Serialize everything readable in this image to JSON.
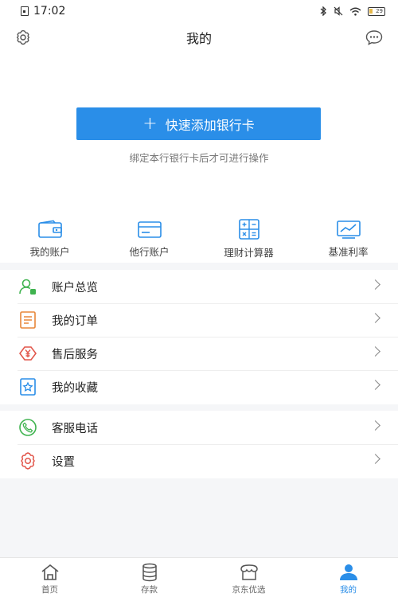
{
  "status_bar": {
    "time": "17:02",
    "battery_level": "29"
  },
  "header": {
    "title": "我的"
  },
  "add_card": {
    "button_label": "快速添加银行卡",
    "hint": "绑定本行银行卡后才可进行操作"
  },
  "quick_entries": [
    {
      "label": "我的账户",
      "icon": "wallet-icon"
    },
    {
      "label": "他行账户",
      "icon": "bank-card-icon"
    },
    {
      "label": "理财计算器",
      "icon": "calculator-icon"
    },
    {
      "label": "基准利率",
      "icon": "trend-chart-icon"
    }
  ],
  "menu_group_1": [
    {
      "label": "账户总览",
      "icon": "user-overview-icon"
    },
    {
      "label": "我的订单",
      "icon": "order-document-icon"
    },
    {
      "label": "售后服务",
      "icon": "yen-service-icon"
    },
    {
      "label": "我的收藏",
      "icon": "favorite-star-icon"
    }
  ],
  "menu_group_2": [
    {
      "label": "客服电话",
      "icon": "phone-icon"
    },
    {
      "label": "设置",
      "icon": "settings-gear-icon"
    }
  ],
  "bottom_nav": {
    "items": [
      {
        "label": "首页",
        "icon": "home-icon"
      },
      {
        "label": "存款",
        "icon": "deposit-coins-icon"
      },
      {
        "label": "京东优选",
        "icon": "store-icon"
      },
      {
        "label": "我的",
        "icon": "profile-icon"
      }
    ],
    "active_index": 3
  },
  "colors": {
    "accent": "#2a8ee8",
    "green": "#3fb34f",
    "orange": "#e8873a",
    "red": "#e2574c"
  }
}
